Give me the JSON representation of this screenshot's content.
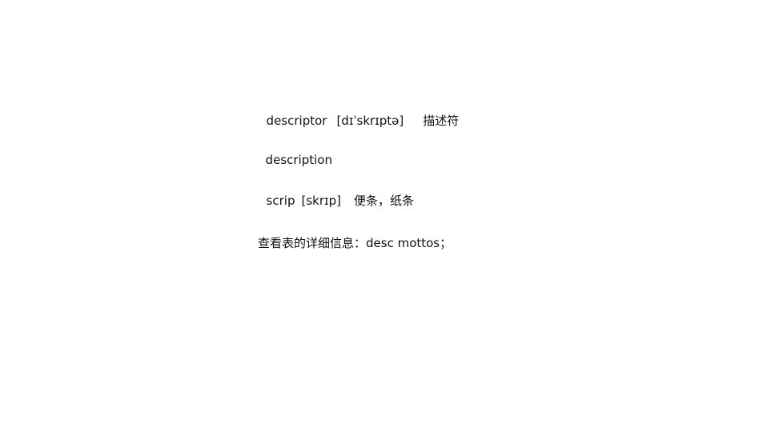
{
  "lines": [
    {
      "word": "descriptor",
      "phonetic": "[dɪˈskrɪptə]",
      "meaning": "描述符"
    },
    {
      "word": "description"
    },
    {
      "word": "scrip",
      "phonetic": "[skrɪp]",
      "meaning": "便条，纸条"
    },
    {
      "text": "查看表的详细信息：desc mottos；"
    }
  ]
}
